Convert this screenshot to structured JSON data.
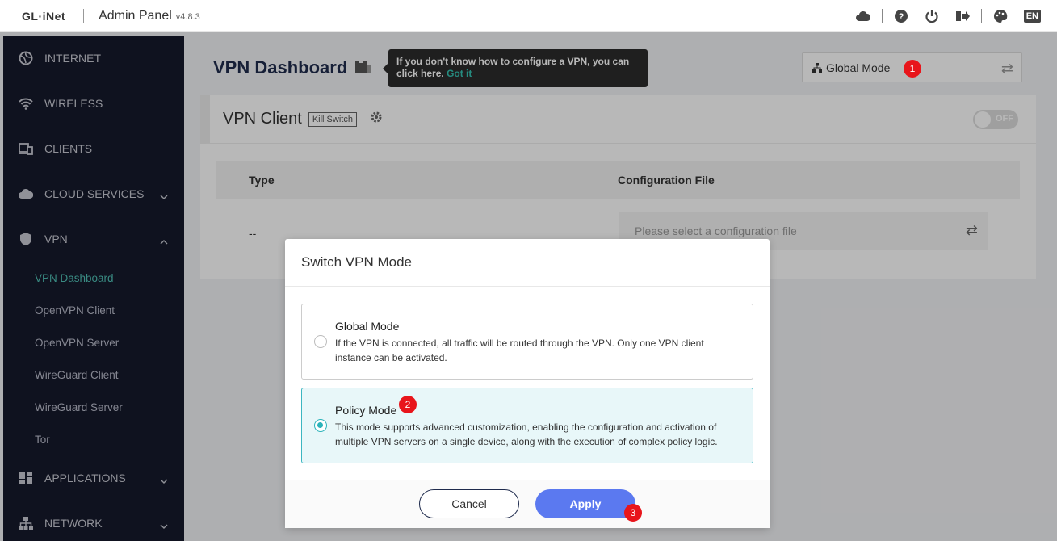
{
  "header": {
    "logo": "GL·iNet",
    "title": "Admin Panel",
    "version": "v4.8.3",
    "lang": "EN"
  },
  "sidebar": {
    "items": [
      {
        "label": "INTERNET",
        "icon": "globe-icon"
      },
      {
        "label": "WIRELESS",
        "icon": "wifi-icon"
      },
      {
        "label": "CLIENTS",
        "icon": "devices-icon"
      },
      {
        "label": "CLOUD SERVICES",
        "icon": "cloud-icon"
      },
      {
        "label": "VPN",
        "icon": "shield-icon"
      }
    ],
    "vpn_sub": [
      "VPN Dashboard",
      "OpenVPN Client",
      "OpenVPN Server",
      "WireGuard Client",
      "WireGuard Server",
      "Tor"
    ],
    "bottom_items": [
      {
        "label": "APPLICATIONS",
        "icon": "apps-icon"
      },
      {
        "label": "NETWORK",
        "icon": "network-icon"
      }
    ]
  },
  "main": {
    "title": "VPN Dashboard",
    "tooltip_text": "If you don't know how to configure a VPN, you can click here.",
    "tooltip_link": "Got it",
    "mode_select": "Global Mode",
    "card": {
      "title": "VPN Client",
      "kill_switch": "Kill Switch",
      "toggle": "OFF",
      "col_type": "Type",
      "col_config": "Configuration File",
      "row_type": "--",
      "config_placeholder": "Please select a configuration file"
    }
  },
  "modal": {
    "title": "Switch VPN Mode",
    "options": [
      {
        "title": "Global Mode",
        "desc": "If the VPN is connected, all traffic will be routed through the VPN. Only one VPN client instance can be activated.",
        "selected": false
      },
      {
        "title": "Policy Mode",
        "desc": "This mode supports advanced customization, enabling the configuration and activation of multiple VPN servers on a single device, along with the execution of complex policy logic.",
        "selected": true
      }
    ],
    "cancel": "Cancel",
    "apply": "Apply"
  },
  "markers": [
    "1",
    "2",
    "3"
  ],
  "colors": {
    "accent": "#2bb3ba",
    "apply": "#5b79f0",
    "sidebar": "#16192b",
    "marker": "#e8151b"
  }
}
